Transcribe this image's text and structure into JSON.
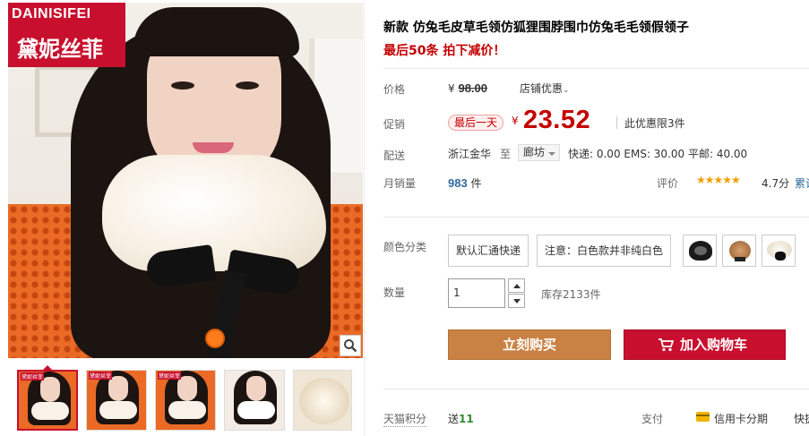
{
  "brand": {
    "name_en": "DAINISIFEI",
    "name_cn": "黛妮丝菲"
  },
  "thumbnails": [
    {
      "label": "黛妮丝菲"
    },
    {
      "label": "黛妮丝菲"
    },
    {
      "label": "黛妮丝菲"
    },
    {
      "label": ""
    },
    {
      "label": ""
    }
  ],
  "product": {
    "title": "新款 仿兔毛皮草毛领仿狐狸围脖围巾仿兔毛毛领假领子",
    "subtitle": "最后50条 拍下减价！"
  },
  "price": {
    "label": "价格",
    "currency": "¥",
    "original": "98.00",
    "shop_deal": "店铺优惠"
  },
  "promo": {
    "label": "促销",
    "badge": "最后一天",
    "currency": "¥",
    "price": "23.52",
    "limit": "此优惠限3件"
  },
  "delivery": {
    "label": "配送",
    "origin": "浙江金华",
    "to": "至",
    "destination": "廊坊",
    "fees": "快递: 0.00 EMS: 30.00 平邮: 40.00"
  },
  "sales": {
    "label": "月销量",
    "count": "983",
    "unit": "件",
    "rating_label": "评价",
    "stars": "★★★★★",
    "score": "4.7分",
    "cumulative": "累计"
  },
  "options": {
    "label": "颜色分类",
    "text_items": [
      "默认汇通快递",
      "注意：白色款并非纯白色"
    ],
    "image_items": [
      "black-fur-swatch",
      "brown-fur-swatch",
      "white-fur-swatch"
    ]
  },
  "quantity": {
    "label": "数量",
    "value": "1",
    "stock": "库存2133件"
  },
  "actions": {
    "buy_now": "立刻购买",
    "add_to_cart": "加入购物车"
  },
  "footer": {
    "points_label": "天猫积分",
    "points_prefix": "送",
    "points_value": "11",
    "pay_label": "支付",
    "pay_method": "信用卡分期",
    "pay_more": "快捷"
  },
  "colors": {
    "accent_red": "#c40000",
    "cart_red": "#c8102e",
    "buy_brown": "#c98243",
    "link_blue": "#2f6a9a",
    "star_gold": "#f0a000"
  }
}
